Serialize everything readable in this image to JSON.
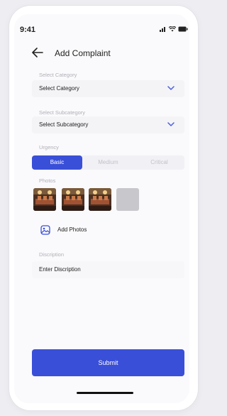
{
  "status_bar": {
    "time": "9:41"
  },
  "header": {
    "title": "Add Complaint"
  },
  "category": {
    "label": "Select Category",
    "value": "Select Category"
  },
  "subcategory": {
    "label": "Select Subcategory",
    "value": "Select Subcategory"
  },
  "urgency": {
    "label": "Urgency",
    "options": [
      "Basic",
      "Medium",
      "Critical"
    ],
    "selected": "Basic"
  },
  "photos": {
    "label": "Photos",
    "add_label": "Add Photos",
    "thumbnail_count": 3
  },
  "description": {
    "label": "Discription",
    "placeholder": "Enter Discription"
  },
  "submit": {
    "label": "Submit"
  },
  "colors": {
    "accent": "#3a4fd8",
    "chevron": "#4a5ee0",
    "field_bg": "#f4f4f7"
  }
}
